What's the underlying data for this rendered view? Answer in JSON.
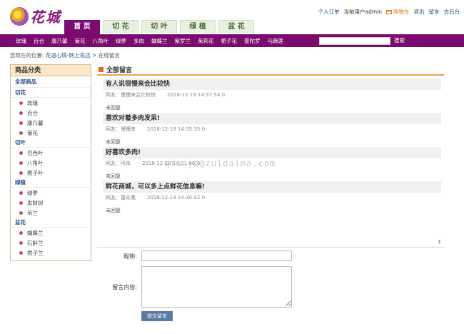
{
  "header": {
    "logo_text": "花城",
    "nav_tabs": [
      {
        "label": "首 页",
        "active": true
      },
      {
        "label": "切 花",
        "active": false
      },
      {
        "label": "切 叶",
        "active": false
      },
      {
        "label": "绿 植",
        "active": false
      },
      {
        "label": "盆 花",
        "active": false
      }
    ],
    "user_links": {
      "personal_order": "个人订单",
      "current_user": "当前用户admin",
      "cart": "购物车",
      "logout": "退出",
      "message": "留言",
      "backend": "去后台"
    }
  },
  "category_bar": {
    "links": [
      "玫瑰",
      "百合",
      "康乃馨",
      "菊花",
      "八角叶",
      "绿萝",
      "多肉",
      "蝴蝶兰",
      "紫罗兰",
      "茉莉花",
      "栀子花",
      "曼陀罗",
      "马蹄莲"
    ],
    "search_value": "",
    "search_button": "搜索"
  },
  "breadcrumb": {
    "prefix": "您现在的位置:",
    "home": "花语心情-网上花店",
    "sep": ">",
    "current": "在线留言"
  },
  "sidebar": {
    "title": "商品分类",
    "all_label": "全部商品",
    "groups": [
      {
        "name": "切花",
        "items": [
          "玫瑰",
          "百合",
          "康乃馨",
          "菊花"
        ]
      },
      {
        "name": "切叶",
        "items": [
          "巴西叶",
          "八角叶",
          "栀子叶"
        ]
      },
      {
        "name": "绿植",
        "items": [
          "绿萝",
          "发财树",
          "吊兰"
        ]
      },
      {
        "name": "盆花",
        "items": [
          "蝴蝶兰",
          "石斛兰",
          "君子兰"
        ]
      }
    ]
  },
  "main": {
    "title": "全部留言",
    "messages": [
      {
        "title": "有人说很慢来会比较快",
        "author": "网友：慢慢来会比较快",
        "time": "2018-12-19 14:37:54.0",
        "reply": "未回复"
      },
      {
        "title": "喜欢对着多肉发呆!",
        "author": "网友：慢慢来",
        "time": "2018-12-19 14:35:35.0",
        "reply": "未回复"
      },
      {
        "title": "好喜欢多肉!",
        "author": "网友：阿朱",
        "time": "2018-12-19 14:31:06.0",
        "reply": "未回复"
      },
      {
        "title": "鲜花商城，可以多上点鲜花信息嘛!",
        "author": "网友：蕾苏鹰",
        "time": "2018-12-19 14:30:42.0",
        "reply": "未回复"
      }
    ],
    "pager": "1"
  },
  "form": {
    "nick_label": "昵称:",
    "nick_value": "",
    "content_label": "留言内容:",
    "content_value": "",
    "submit_label": "提交留言"
  },
  "watermark": "qianjc@zuidaima.com",
  "colors": {
    "brand_purple": "#7b0b6f",
    "accent_orange": "#f0a04a",
    "link_blue": "#2b4f8a",
    "button_blue": "#5a79a6"
  }
}
